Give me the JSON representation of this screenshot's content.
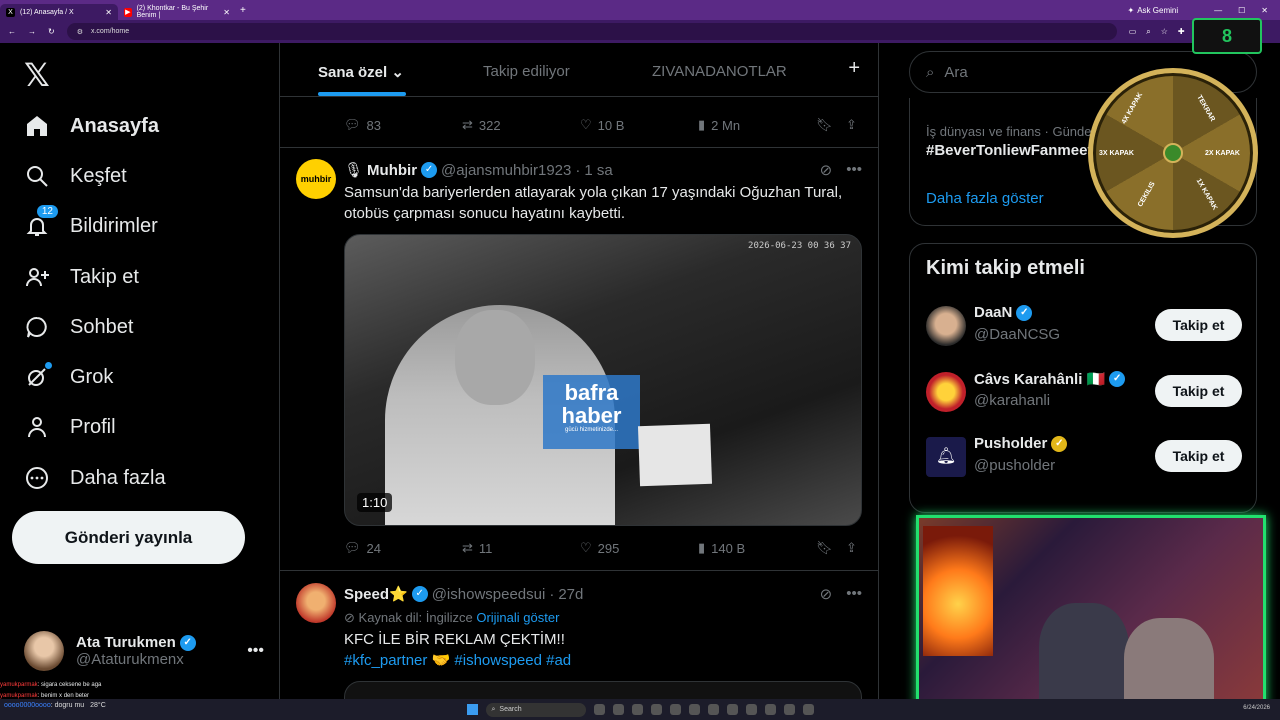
{
  "browser": {
    "tabs": [
      {
        "label": "(12) Anasayfa / X",
        "active": true
      },
      {
        "label": "(2) Khontkar - Bu Şehir Benim |",
        "active": false
      }
    ],
    "url": "x.com/home",
    "gemini_label": "Ask Gemini"
  },
  "nav": {
    "items": [
      {
        "label": "Anasayfa",
        "icon": "home-icon"
      },
      {
        "label": "Keşfet",
        "icon": "search-icon"
      },
      {
        "label": "Bildirimler",
        "icon": "bell-icon",
        "badge": "12"
      },
      {
        "label": "Takip et",
        "icon": "follow-icon"
      },
      {
        "label": "Sohbet",
        "icon": "chat-icon"
      },
      {
        "label": "Grok",
        "icon": "grok-icon"
      },
      {
        "label": "Profil",
        "icon": "profile-icon"
      },
      {
        "label": "Daha fazla",
        "icon": "more-icon"
      }
    ],
    "post_button": "Gönderi yayınla",
    "account": {
      "name": "Ata Turukmen",
      "handle": "@Ataturukmenx"
    }
  },
  "timeline": {
    "tabs": [
      "Sana özel",
      "Takip ediliyor",
      "ZIVANADANOTLAR"
    ],
    "tweets": [
      {
        "actions": {
          "replies": "83",
          "reposts": "322",
          "likes": "10 B",
          "views": "2 Mn"
        }
      },
      {
        "name": "Muhbir",
        "handle": "@ajansmuhbir1923",
        "time": "1 sa",
        "text": "Samsun'da bariyerlerden atlayarak yola çıkan 17 yaşındaki Oğuzhan Tural, otobüs çarpması sonucu hayatını kaybetti.",
        "media": {
          "timestamp": "2026-06-23 00 36 37",
          "watermark_1": "bafra",
          "watermark_2": "haber",
          "watermark_3": "gücü hizmetinizde...",
          "duration": "1:10"
        },
        "actions": {
          "replies": "24",
          "reposts": "11",
          "likes": "295",
          "views": "140 B"
        }
      },
      {
        "name": "Speed⭐",
        "handle": "@ishowspeedsui",
        "time": "27d",
        "translation_label": "Kaynak dil: İngilizce",
        "translation_link": "Orijinali göster",
        "text": "KFC İLE BİR REKLAM ÇEKTİM!!",
        "hashtags": "#kfc_partner 🤝 #ishowspeed #ad"
      }
    ]
  },
  "sidebar": {
    "search_placeholder": "Ara",
    "trend": {
      "category": "İş dünyası ve finans · Gündem",
      "tag": "#BeverTonliewFanmeet",
      "show_more": "Daha fazla göster"
    },
    "who_to_follow": {
      "title": "Kimi takip etmeli",
      "follow_label": "Takip et",
      "users": [
        {
          "name": "DaaN",
          "handle": "@DaaNCSG"
        },
        {
          "name": "Câvs Karahânli 🇮🇹",
          "handle": "@karahanli"
        },
        {
          "name": "Pusholder",
          "handle": "@pusholder"
        }
      ]
    }
  },
  "overlay": {
    "counter": "8",
    "wheel_labels": [
      "4X KAPAK",
      "TEKRAR",
      "2X KAPAK",
      "1X KAPAK",
      "CEKILIS",
      "3X KAPAK"
    ]
  },
  "chat": [
    {
      "user": "yamukparmak",
      "msg": ": sigara ceksene be aga"
    },
    {
      "user": "yamukparmak",
      "msg": ": benim x den beter"
    },
    {
      "user": "oooo0000oooo",
      "msg": ": dogru mu"
    }
  ],
  "taskbar": {
    "search": "Search",
    "temp": "28°C",
    "date": "6/24/2026"
  },
  "colors": {
    "accent": "#1d9bf0",
    "chrome": "#5b2a86",
    "background": "#000000",
    "webcam_border": "#22e06e"
  }
}
